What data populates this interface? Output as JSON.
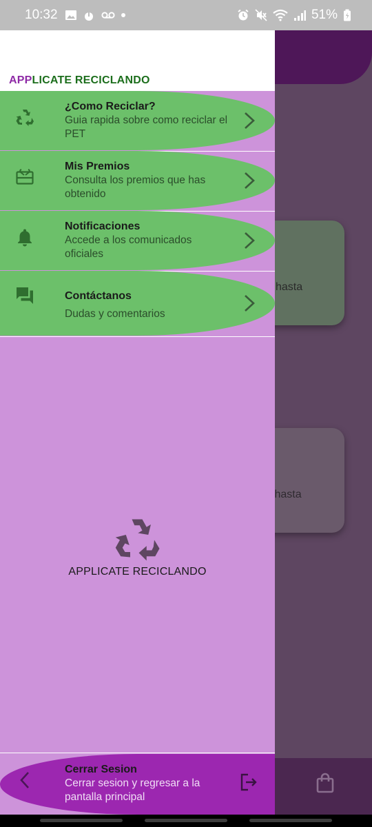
{
  "status_bar": {
    "time": "10:32",
    "battery": "51%",
    "left_icons": [
      "image-icon",
      "upload-icon",
      "voicemail-icon",
      "dot-icon"
    ],
    "right_icons": [
      "alarm-icon",
      "mute-icon",
      "wifi-icon",
      "signal-icon",
      "battery-icon"
    ]
  },
  "background_app": {
    "card1_text": "hasta",
    "card2_text": "s hasta",
    "bottom_icon": "shopping-bag-icon",
    "colors": {
      "appbar": "#4e1758",
      "scrim": "#5e4661"
    }
  },
  "drawer": {
    "title_part1": "APP",
    "title_part2": "LICATE RECICLANDO",
    "menu": [
      {
        "title": "¿Como Reciclar?",
        "subtitle": "Guia rapida sobre como reciclar el PET",
        "icon": "recycle-icon"
      },
      {
        "title": "Mis Premios",
        "subtitle": "Consulta los premios que has obtenido",
        "icon": "gift-card-icon"
      },
      {
        "title": "Notificaciones",
        "subtitle": "Accede a los comunicados oficiales",
        "icon": "bell-icon"
      },
      {
        "title": "Contáctanos",
        "subtitle": "Dudas y comentarios",
        "icon": "forum-icon"
      }
    ],
    "center_label": "APPLICATE RECICLANDO",
    "logout": {
      "title": "Cerrar Sesion",
      "subtitle": "Cerrar sesion y regresar a la pantalla principal",
      "icon": "logout-icon"
    },
    "colors": {
      "drawer_bg": "#cd93da",
      "menu_pill": "#6cc06a",
      "logout_pill": "#9c27b0",
      "title_purple": "#8e2aa6",
      "title_green": "#1c6e1c"
    }
  }
}
